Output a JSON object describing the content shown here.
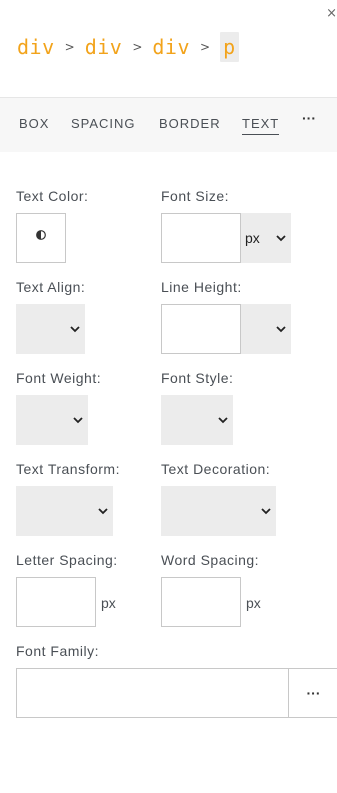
{
  "header": {
    "close_glyph": "×"
  },
  "breadcrumb": {
    "items": [
      "div",
      "div",
      "div",
      "p"
    ],
    "separator": ">"
  },
  "tabs": {
    "items": [
      "BOX",
      "SPACING",
      "BORDER",
      "TEXT"
    ],
    "active": "TEXT",
    "more_label": "···"
  },
  "fields": {
    "text_color": {
      "label": "Text Color:",
      "icon": "half-circle-icon"
    },
    "font_size": {
      "label": "Font Size:",
      "value": "",
      "unit": "px"
    },
    "text_align": {
      "label": "Text Align:",
      "value": ""
    },
    "line_height": {
      "label": "Line Height:",
      "value": "",
      "unit": ""
    },
    "font_weight": {
      "label": "Font Weight:",
      "value": ""
    },
    "font_style": {
      "label": "Font Style:",
      "value": ""
    },
    "text_transform": {
      "label": "Text Transform:",
      "value": ""
    },
    "text_decoration": {
      "label": "Text Decoration:",
      "value": ""
    },
    "letter_spacing": {
      "label": "Letter Spacing:",
      "value": "",
      "unit": "px"
    },
    "word_spacing": {
      "label": "Word Spacing:",
      "value": "",
      "unit": "px"
    },
    "font_family": {
      "label": "Font Family:",
      "value": "",
      "more_label": "···"
    }
  },
  "colors": {
    "breadcrumb": "#f2a31b",
    "tabbar_bg": "#f7f7f7",
    "select_bg": "#ececec",
    "text": "#4a4f55"
  }
}
